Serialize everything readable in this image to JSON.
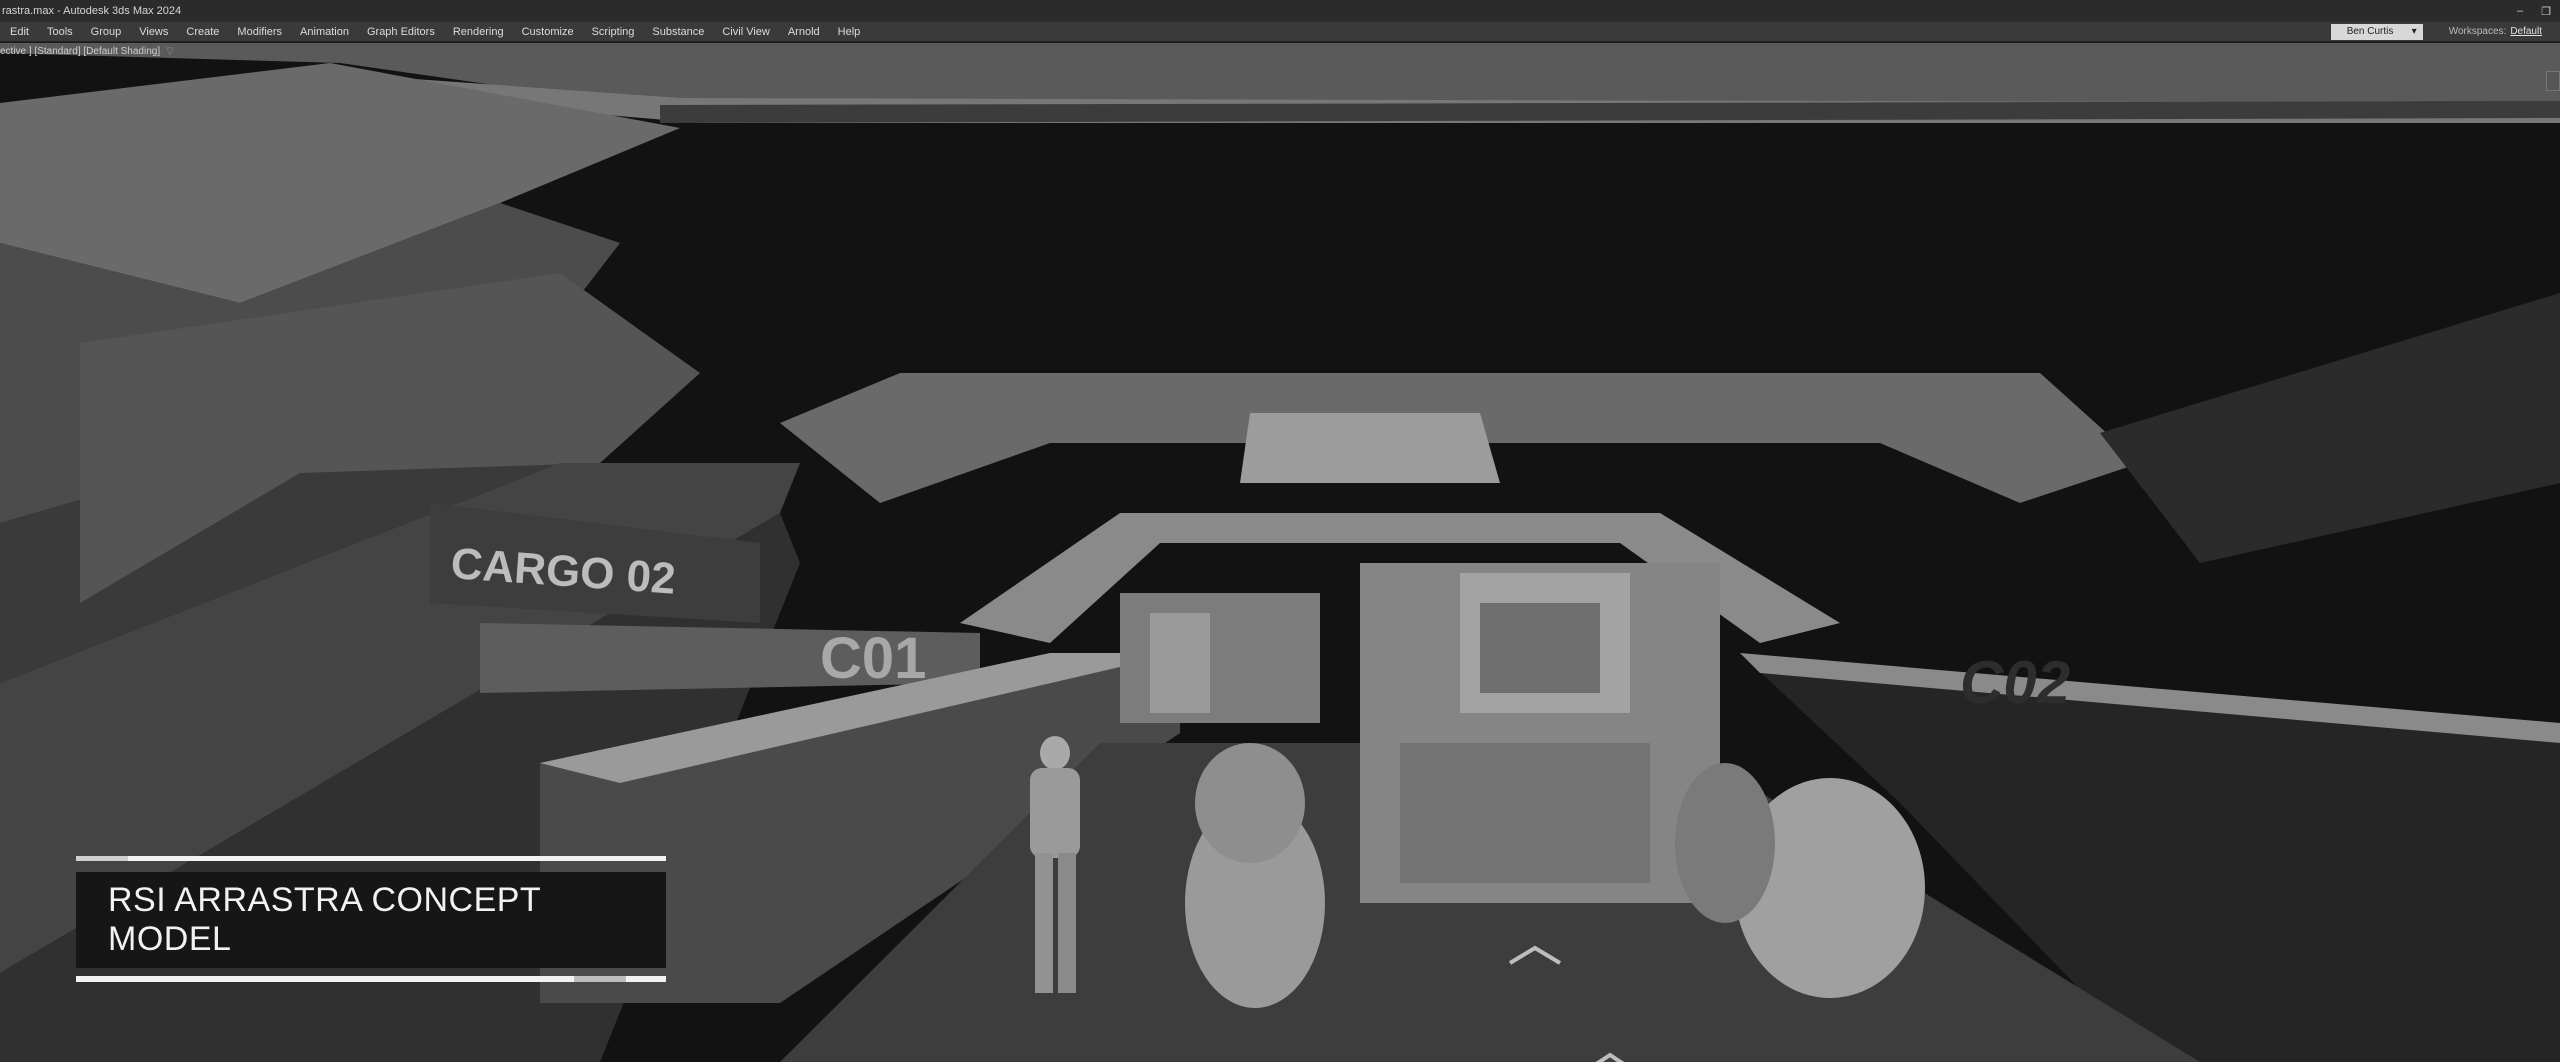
{
  "window": {
    "title": "rastra.max - Autodesk 3ds Max 2024",
    "controls": [
      "minimize",
      "restore"
    ]
  },
  "menu": {
    "items": [
      "Edit",
      "Tools",
      "Group",
      "Views",
      "Create",
      "Modifiers",
      "Animation",
      "Graph Editors",
      "Rendering",
      "Customize",
      "Scripting",
      "Substance",
      "Civil View",
      "Arnold",
      "Help"
    ],
    "user": "Ben Curtis",
    "workspaces_label": "Workspaces:",
    "workspaces_value": "Default"
  },
  "viewport": {
    "label": "ective ] [Standard] [Default Shading]",
    "filter_icon": "filter-icon",
    "scene_text": {
      "cargo_left": "CARGO 02",
      "bay_left": "C01",
      "bay_right": "C02"
    }
  },
  "banner": {
    "title": "RSI ARRASTRA CONCEPT MODEL"
  },
  "colors": {
    "menubar": "#3a3a3a",
    "titlebar": "#2b2b2b",
    "banner_bg": "#161616",
    "banner_line": "#f2f2f2"
  }
}
